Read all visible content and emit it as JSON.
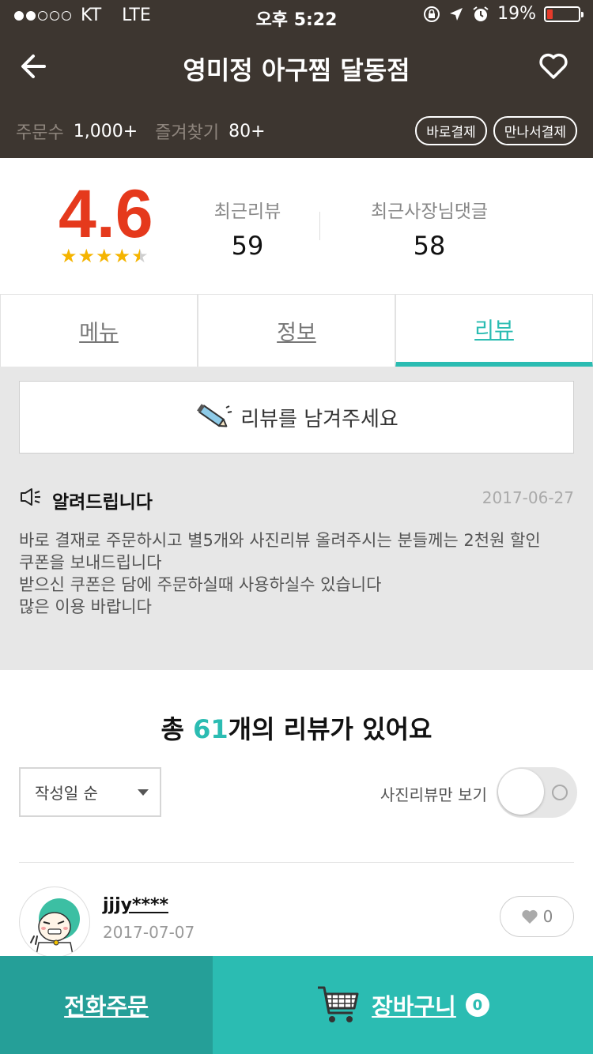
{
  "status_bar": {
    "carrier": "KT",
    "network": "LTE",
    "time": "오후 5:22",
    "battery": "19%",
    "battery_level": 0.19
  },
  "header": {
    "title": "영미정 아구찜 달동점",
    "orders_label": "주문수",
    "orders_value": "1,000+",
    "favorites_label": "즐겨찾기",
    "favorites_value": "80+",
    "badges": [
      "바로결제",
      "만나서결제"
    ],
    "back_icon": "arrow-left-icon",
    "favorite_icon": "heart-icon"
  },
  "rating": {
    "score": "4.6",
    "stars": 4.5,
    "recent_reviews_label": "최근리뷰",
    "recent_reviews_value": "59",
    "owner_replies_label": "최근사장님댓글",
    "owner_replies_value": "58"
  },
  "tabs": [
    {
      "label": "메뉴",
      "active": false
    },
    {
      "label": "정보",
      "active": false
    },
    {
      "label": "리뷰",
      "active": true
    }
  ],
  "review_write": {
    "label": "리뷰를 남겨주세요"
  },
  "notice": {
    "title": "알려드립니다",
    "date": "2017-06-27",
    "lines": [
      "바로 결재로 주문하시고 별5개와 사진리뷰 올려주시는 분들께는 2천원 할인",
      "쿠폰을 보내드립니다",
      "받으신 쿠폰은 담에 주문하실때 사용하실수 있습니다",
      "많은 이용 바랍니다"
    ]
  },
  "review_summary": {
    "prefix": "총 ",
    "count": "61",
    "suffix": "개의 리뷰가 있어요",
    "sort_selected": "작성일 순",
    "photo_only_label": "사진리뷰만 보기",
    "photo_only_on": false
  },
  "reviews": [
    {
      "user": "jjjy****",
      "date": "2017-07-07",
      "likes": "0"
    }
  ],
  "bottom_bar": {
    "call_label": "전화주문",
    "cart_label": "장바구니",
    "cart_count": "0"
  },
  "colors": {
    "header_bg": "#3d3630",
    "accent": "#2bbcb2",
    "score": "#e5391c",
    "star": "#f5b400"
  }
}
